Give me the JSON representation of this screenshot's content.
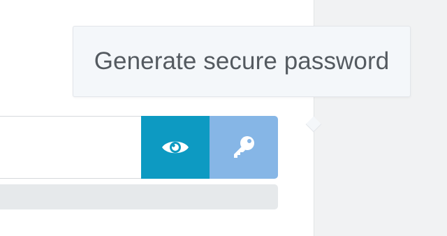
{
  "tooltip": {
    "text": "Generate secure password"
  },
  "password_field": {
    "value": "",
    "show_button_icon": "eye-icon",
    "generate_button_icon": "key-icon"
  },
  "colors": {
    "show_button": "#0d9ac2",
    "generate_button": "#86b6e6",
    "tooltip_bg": "#f4f7fa",
    "strength_meter": "#e6e9eb"
  }
}
